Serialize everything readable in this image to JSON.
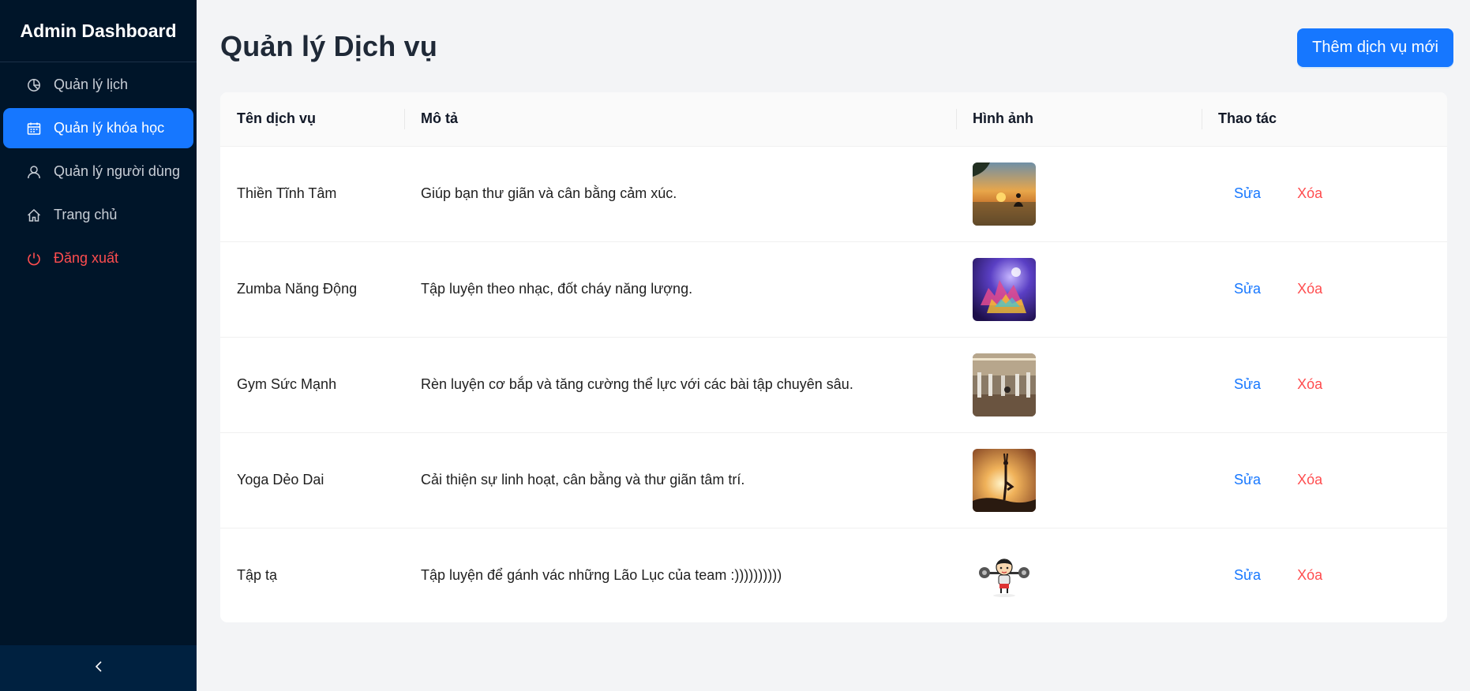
{
  "sidebar": {
    "title": "Admin Dashboard",
    "items": [
      {
        "label": "Quản lý lịch",
        "icon": "pie-chart-icon"
      },
      {
        "label": "Quản lý khóa học",
        "icon": "schedule-icon"
      },
      {
        "label": "Quản lý người dùng",
        "icon": "user-icon"
      },
      {
        "label": "Trang chủ",
        "icon": "home-icon"
      },
      {
        "label": "Đăng xuất",
        "icon": "power-icon"
      }
    ],
    "active_index": 1,
    "collapse_icon": "chevron-left-icon"
  },
  "page": {
    "title": "Quản lý Dịch vụ",
    "add_button": "Thêm dịch vụ mới"
  },
  "table": {
    "columns": [
      "Tên dịch vụ",
      "Mô tả",
      "Hình ảnh",
      "Thao tác"
    ],
    "rows": [
      {
        "name": "Thiền Tĩnh Tâm",
        "description": "Giúp bạn thư giãn và cân bằng cảm xúc.",
        "image": "meditation-sunset-image",
        "edit": "Sửa",
        "delete": "Xóa"
      },
      {
        "name": "Zumba Năng Động",
        "description": "Tập luyện theo nhạc, đốt cháy năng lượng.",
        "image": "zumba-dance-image",
        "edit": "Sửa",
        "delete": "Xóa"
      },
      {
        "name": "Gym Sức Mạnh",
        "description": "Rèn luyện cơ bắp và tăng cường thể lực với các bài tập chuyên sâu.",
        "image": "gym-room-image",
        "edit": "Sửa",
        "delete": "Xóa"
      },
      {
        "name": "Yoga Dẻo Dai",
        "description": "Cải thiện sự linh hoạt, cân bằng và thư giãn tâm trí.",
        "image": "yoga-silhouette-image",
        "edit": "Sửa",
        "delete": "Xóa"
      },
      {
        "name": "Tập tạ",
        "description": "Tập luyện để gánh vác những Lão Lục của team :))))))))))",
        "image": "cartoon-weightlifter-image",
        "edit": "Sửa",
        "delete": "Xóa"
      }
    ]
  },
  "colors": {
    "sidebar_bg": "#001529",
    "accent": "#1677ff",
    "danger": "#ff4d4f"
  }
}
